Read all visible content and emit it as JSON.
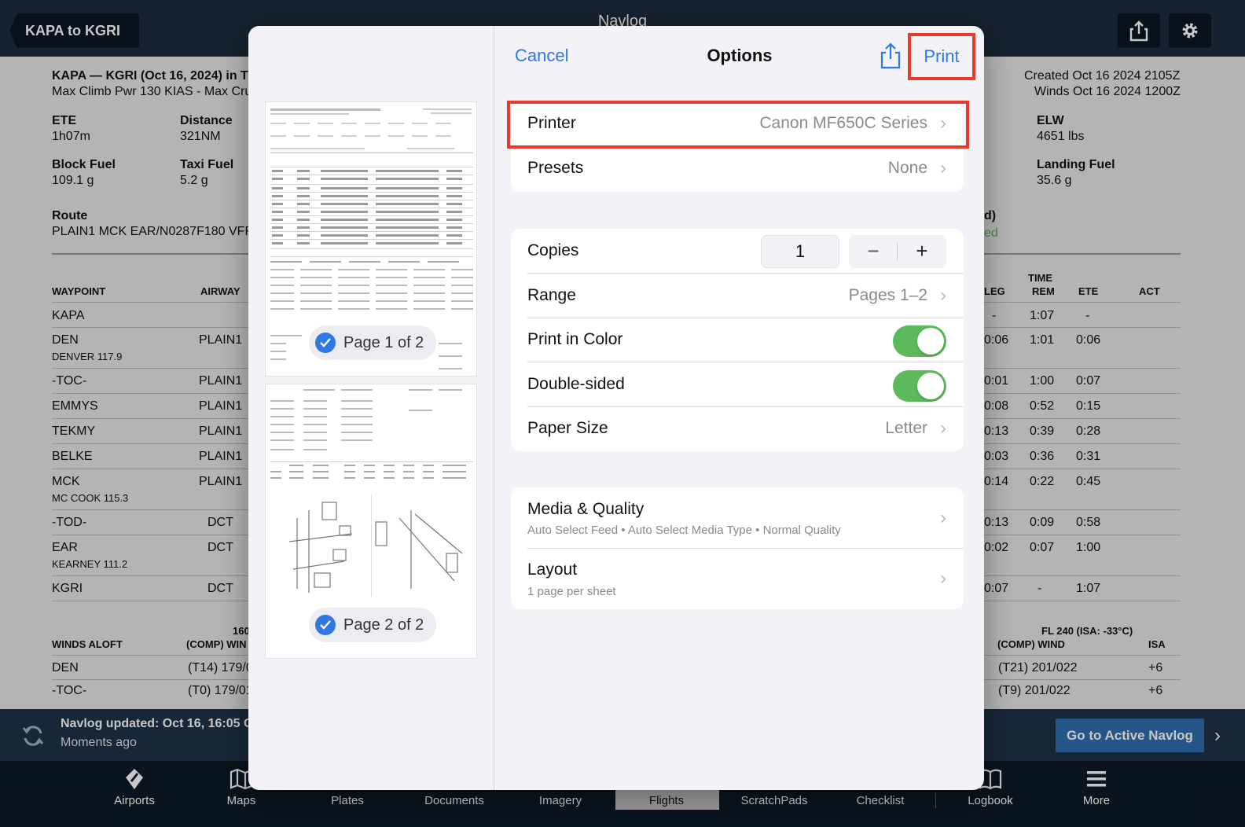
{
  "topbar": {
    "back_label": "KAPA to KGRI",
    "title": "Navlog",
    "share_icon": "share-icon",
    "settings_icon": "gear-icon"
  },
  "navlog": {
    "header_title": "KAPA — KGRI (Oct 16, 2024) in T",
    "header_sub": "Max Climb Pwr 130 KIAS - Max Cru",
    "created": "Created Oct 16 2024 2105Z",
    "winds": "Winds Oct 16 2024 1200Z",
    "ete_label": "ETE",
    "ete_value": "1h07m",
    "distance_label": "Distance",
    "distance_value": "321NM",
    "elw_label": "ELW",
    "elw_value": "4651 lbs",
    "block_fuel_label": "Block Fuel",
    "block_fuel_value": "109.1 g",
    "taxi_fuel_label": "Taxi Fuel",
    "taxi_fuel_value": "5.2 g",
    "landing_fuel_label": "Landing Fuel",
    "landing_fuel_value": "35.6 g",
    "route_label": "Route",
    "route_value": "PLAIN1 MCK EAR/N0287F180 VFR",
    "right_frag1": "d)",
    "right_frag2": "ed",
    "col_waypoint": "WAYPOINT",
    "col_airway": "AIRWAY",
    "col_leg": "LEG",
    "col_time": "TIME",
    "col_rem": "REM",
    "col_ete": "ETE",
    "col_act": "ACT",
    "rows": [
      {
        "wp": "KAPA",
        "sub": "",
        "airway": "",
        "leg": "-",
        "rem": "1:07",
        "ete": "-"
      },
      {
        "wp": "DEN",
        "sub": "DENVER 117.9",
        "airway": "PLAIN1",
        "leg": "0:06",
        "rem": "1:01",
        "ete": "0:06"
      },
      {
        "wp": "-TOC-",
        "sub": "",
        "airway": "PLAIN1",
        "leg": "0:01",
        "rem": "1:00",
        "ete": "0:07"
      },
      {
        "wp": "EMMYS",
        "sub": "",
        "airway": "PLAIN1",
        "leg": "0:08",
        "rem": "0:52",
        "ete": "0:15"
      },
      {
        "wp": "TEKMY",
        "sub": "",
        "airway": "PLAIN1",
        "leg": "0:13",
        "rem": "0:39",
        "ete": "0:28"
      },
      {
        "wp": "BELKE",
        "sub": "",
        "airway": "PLAIN1",
        "leg": "0:03",
        "rem": "0:36",
        "ete": "0:31"
      },
      {
        "wp": "MCK",
        "sub": "MC COOK 115.3",
        "airway": "PLAIN1",
        "leg": "0:14",
        "rem": "0:22",
        "ete": "0:45"
      },
      {
        "wp": "-TOD-",
        "sub": "",
        "airway": "DCT",
        "leg": "0:13",
        "rem": "0:09",
        "ete": "0:58"
      },
      {
        "wp": "EAR",
        "sub": "KEARNEY 111.2",
        "airway": "DCT",
        "leg": "0:02",
        "rem": "0:07",
        "ete": "1:00"
      },
      {
        "wp": "KGRI",
        "sub": "",
        "airway": "DCT",
        "leg": "0:07",
        "rem": "-",
        "ete": "1:07"
      }
    ],
    "winds_label": "WINDS ALOFT",
    "winds_col_fl": "160",
    "winds_col_comp": "(COMP) WIN",
    "winds_right_fl": "FL 240 (ISA: -33°C)",
    "winds_right_comp": "(COMP) WIND",
    "winds_right_isa": "ISA",
    "winds_rows": [
      {
        "wp": "DEN",
        "left": "(T14) 179/0",
        "right": "(T21) 201/022",
        "isa": "+6"
      },
      {
        "wp": "-TOC-",
        "left": "(T0) 179/01",
        "right": "(T9) 201/022",
        "isa": "+6"
      }
    ]
  },
  "banner": {
    "title": "Navlog updated: Oct 16, 16:05 C",
    "subtitle": "Moments ago",
    "button": "Go to Active Navlog"
  },
  "tabs": [
    {
      "label": "Airports",
      "icon": "airport-icon"
    },
    {
      "label": "Maps",
      "icon": "map-icon"
    },
    {
      "label": "Plates",
      "icon": "plates-icon"
    },
    {
      "label": "Documents",
      "icon": "documents-icon"
    },
    {
      "label": "Imagery",
      "icon": "imagery-icon"
    },
    {
      "label": "Flights",
      "icon": "flights-icon"
    },
    {
      "label": "ScratchPads",
      "icon": "scratchpad-icon"
    },
    {
      "label": "Checklist",
      "icon": "checklist-icon"
    },
    {
      "label": "Logbook",
      "icon": "logbook-icon"
    },
    {
      "label": "More",
      "icon": "menu-icon"
    }
  ],
  "print_sheet": {
    "cancel": "Cancel",
    "title": "Options",
    "print": "Print",
    "page1_badge": "Page 1 of 2",
    "page2_badge": "Page 2 of 2",
    "printer_label": "Printer",
    "printer_value": "Canon MF650C Series",
    "presets_label": "Presets",
    "presets_value": "None",
    "copies_label": "Copies",
    "copies_value": "1",
    "range_label": "Range",
    "range_value": "Pages 1–2",
    "color_label": "Print in Color",
    "color_on": true,
    "duplex_label": "Double-sided",
    "duplex_on": true,
    "paper_label": "Paper Size",
    "paper_value": "Letter",
    "media_label": "Media & Quality",
    "media_sub": "Auto Select Feed • Auto Select Media Type • Normal Quality",
    "layout_label": "Layout",
    "layout_sub": "1 page per sheet"
  },
  "colors": {
    "accent": "#2f78e6",
    "highlight": "#e53a2d",
    "toggle_on": "#5cba5c",
    "nav_bg": "#1d2c3d"
  }
}
